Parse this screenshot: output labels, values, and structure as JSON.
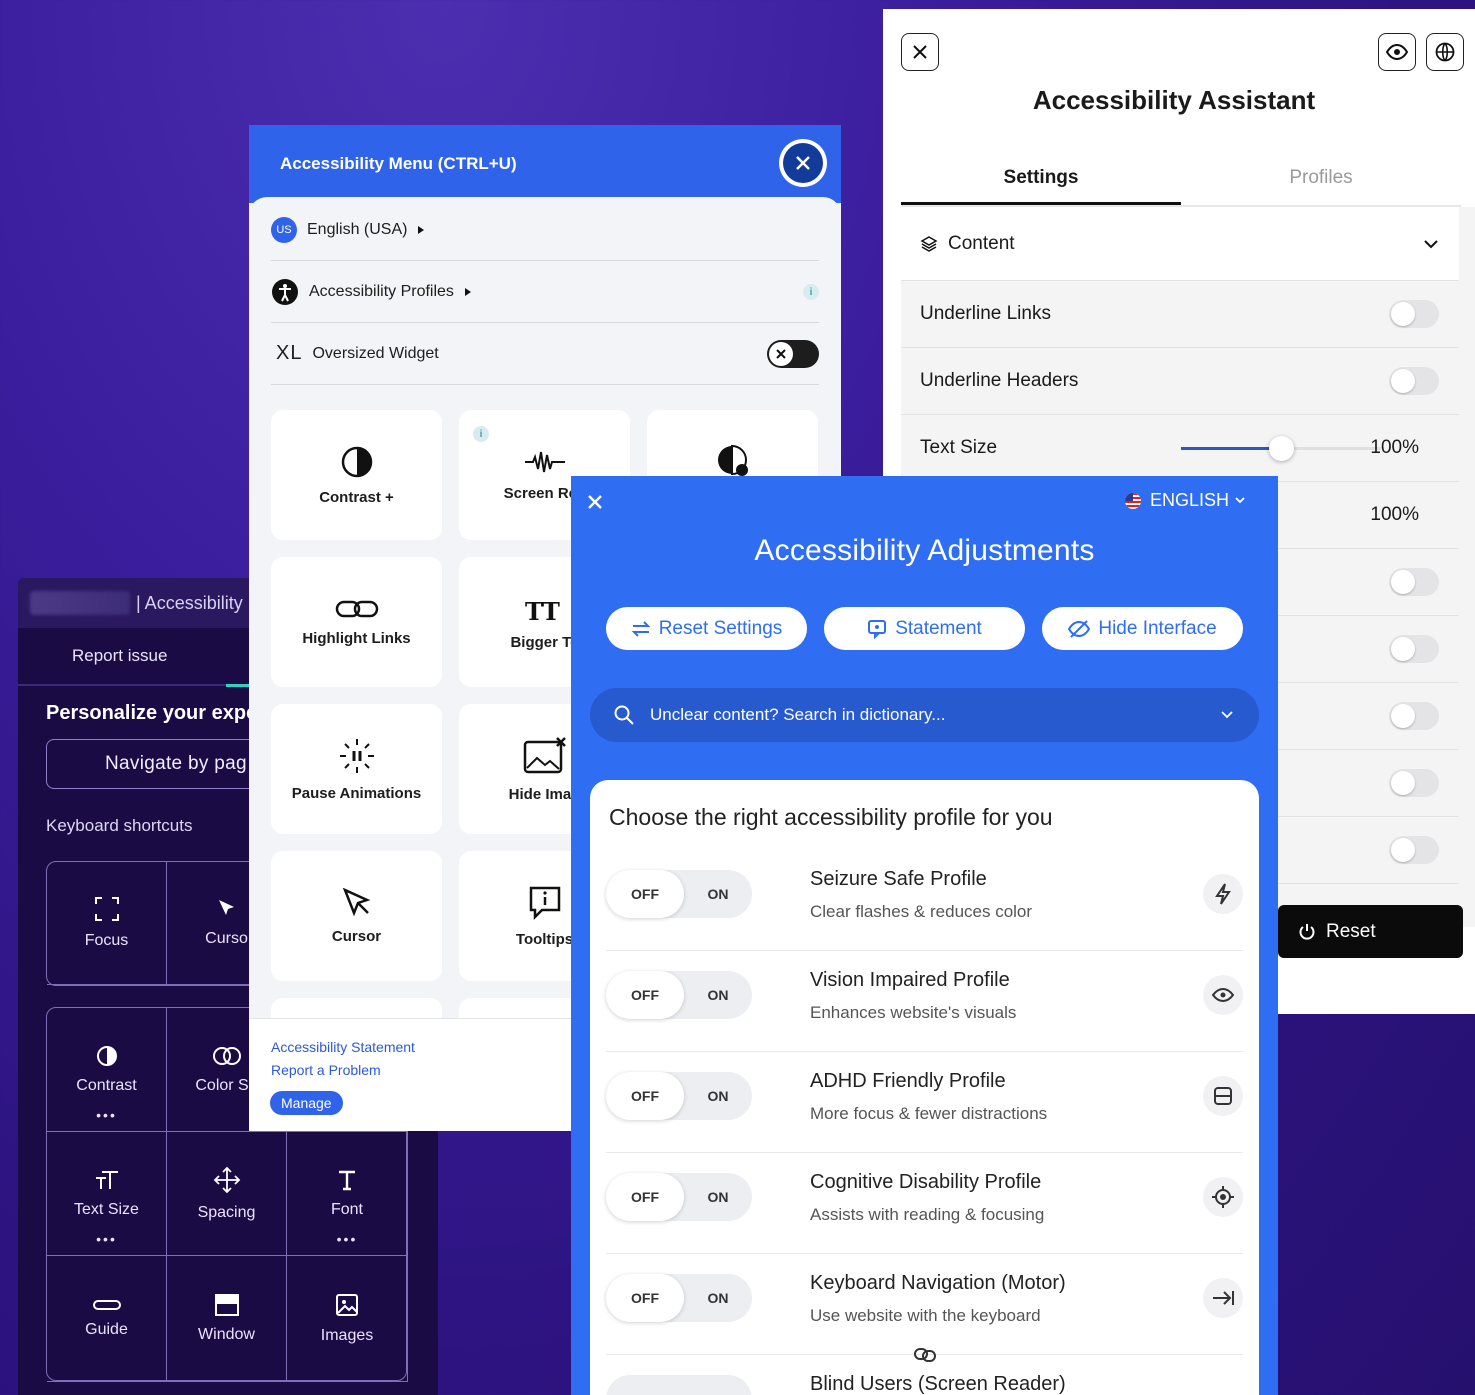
{
  "dark_panel": {
    "title": "| Accessibility",
    "tab": "Report issue",
    "heading": "Personalize your expe",
    "navigate_button": "Navigate by pag",
    "shortcuts_label": "Keyboard shortcuts",
    "row1": [
      {
        "label": "Focus",
        "icon": "focus-icon"
      },
      {
        "label": "Curso",
        "icon": "cursor-icon"
      }
    ],
    "grid": [
      {
        "label": "Contrast",
        "icon": "contrast-icon",
        "dots": "•••"
      },
      {
        "label": "Color Sh",
        "icon": "color-shift-icon",
        "dots": ""
      },
      {
        "label": "",
        "icon": "",
        "dots": ""
      },
      {
        "label": "Text Size",
        "icon": "text-size-icon",
        "dots": "•••"
      },
      {
        "label": "Spacing",
        "icon": "spacing-icon",
        "dots": ""
      },
      {
        "label": "Font",
        "icon": "font-icon",
        "dots": "•••"
      },
      {
        "label": "Guide",
        "icon": "guide-icon",
        "dots": ""
      },
      {
        "label": "Window",
        "icon": "window-icon",
        "dots": ""
      },
      {
        "label": "Images",
        "icon": "images-icon",
        "dots": ""
      }
    ]
  },
  "white_panel": {
    "title": "Accessibility Assistant",
    "tabs": [
      "Settings",
      "Profiles"
    ],
    "section": "Content",
    "rows": [
      {
        "label": "Underline Links",
        "on": false
      },
      {
        "label": "Underline Headers",
        "on": false
      }
    ],
    "text_size": {
      "label": "Text Size",
      "value": "100%",
      "level": 0.5
    },
    "second_slider": {
      "value": "100%",
      "level": 0.5
    },
    "reset_label": "Reset"
  },
  "menu_panel": {
    "title": "Accessibility Menu (CTRL+U)",
    "language": "English (USA)",
    "language_badge": "US",
    "profiles": "Accessibility Profiles",
    "oversized_prefix": "XL",
    "oversized": "Oversized Widget",
    "info_glyph": "i",
    "cards": [
      {
        "label": "Contrast +",
        "icon": "contrast-icon"
      },
      {
        "label": "Screen Rea",
        "icon": "screen-reader-icon"
      },
      {
        "label": "",
        "icon": "saturation-icon"
      },
      {
        "label": "Highlight Links",
        "icon": "link-icon"
      },
      {
        "label": "Bigger Te",
        "icon": "bigger-text-icon"
      },
      {
        "label": "Pause Animations",
        "icon": "pause-animations-icon"
      },
      {
        "label": "Hide Imag",
        "icon": "hide-images-icon"
      },
      {
        "label": "Cursor",
        "icon": "cursor-icon"
      },
      {
        "label": "Tooltips",
        "icon": "tooltips-icon"
      }
    ],
    "statement_link": "Accessibility Statement",
    "report_link": "Report a Problem",
    "manage": "Manage"
  },
  "adjust_panel": {
    "language": "ENGLISH",
    "title": "Accessibility Adjustments",
    "buttons": [
      "Reset Settings",
      "Statement",
      "Hide Interface"
    ],
    "search_placeholder": "Unclear content? Search in dictionary...",
    "card_title": "Choose the right accessibility profile for you",
    "off_label": "OFF",
    "on_label": "ON",
    "profiles": [
      {
        "name": "Seizure Safe Profile",
        "desc": "Clear flashes & reduces color",
        "icon": "lightning-icon"
      },
      {
        "name": "Vision Impaired Profile",
        "desc": "Enhances website's visuals",
        "icon": "eye-icon"
      },
      {
        "name": "ADHD Friendly Profile",
        "desc": "More focus & fewer distractions",
        "icon": "focus-box-icon"
      },
      {
        "name": "Cognitive Disability Profile",
        "desc": "Assists with reading & focusing",
        "icon": "target-icon"
      },
      {
        "name": "Keyboard Navigation (Motor)",
        "desc": "Use website with the keyboard",
        "icon": "tab-arrow-icon"
      },
      {
        "name": "Blind Users (Screen Reader)",
        "desc": "",
        "icon": ""
      }
    ]
  }
}
